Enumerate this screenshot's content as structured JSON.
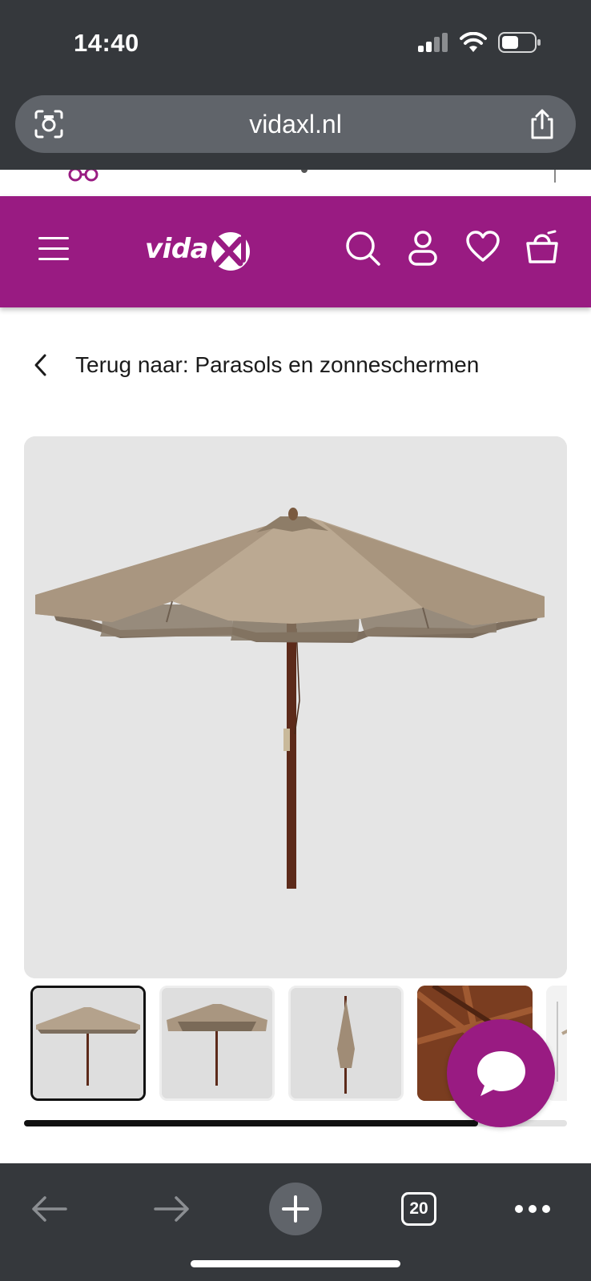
{
  "status_bar": {
    "time": "14:40"
  },
  "browser": {
    "url": "vidaxl.nl",
    "tab_count": "20"
  },
  "header": {
    "logo_text": "vida",
    "logo_badge_text": "xl",
    "icons": [
      "menu-icon",
      "search-icon",
      "account-icon",
      "heart-icon",
      "cart-icon"
    ],
    "background_color": "#991b82"
  },
  "breadcrumb": {
    "back_label": "Terug naar: Parasols en zonneschermen"
  },
  "gallery": {
    "thumbnail_count_visible": 5,
    "active_index": 0,
    "scroll_progress": 0.84
  },
  "chat": {
    "icon": "chat-bubble-icon",
    "color": "#991b82"
  },
  "toolbar": {
    "items": [
      "back-arrow-icon",
      "forward-arrow-icon",
      "new-tab-plus-icon",
      "tabs-count-icon",
      "more-dots-icon"
    ]
  }
}
